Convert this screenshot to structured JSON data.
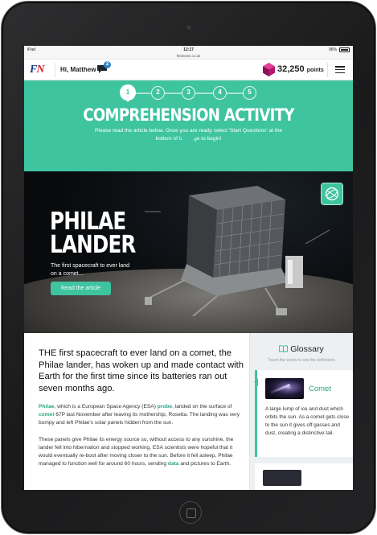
{
  "status_bar": {
    "device": "iPad",
    "time": "12:17",
    "url": "firstnews.co.uk",
    "battery": "96%"
  },
  "header": {
    "logo_first": "F",
    "logo_second": "N",
    "greeting": "Hi, Matthew",
    "message_count": "2",
    "points_value": "32,250",
    "points_unit": "points"
  },
  "activity": {
    "steps": [
      "1",
      "2",
      "3",
      "4",
      "5"
    ],
    "current_step": 1,
    "title": "COMPREHENSION ACTIVITY",
    "description": "Please read the article below. Once you are ready select 'Start Questions' at the bottom of the page to begin!"
  },
  "hero": {
    "title_line1": "PHILAE",
    "title_line2": "LANDER",
    "subtitle": "The first spacecraft to ever land on a comet...",
    "button": "Read the article"
  },
  "article": {
    "lead": "THE first spacecraft to ever land on a comet, the Philae lander, has woken up and made contact with Earth for the first time since its batteries ran out seven months ago.",
    "p1": {
      "kw1": "Philae",
      "t1": ", which is a European Space Agency (ESA) ",
      "kw2": "probe",
      "t2": ", landed on the surface of ",
      "kw3": "comet",
      "t3": " 67P last November after leaving its mothership, Rosetta. The landing was very bumpy and left Philae's solar panels hidden from the sun."
    },
    "p2": {
      "t1": "These panels give Philae its energy source so, without access to any sunshine, the lander fell into hibernation and stopped working. ESA scientists were hopeful that it would eventually re-boot after moving closer to the sun. Before it fell asleep, Philae managed to function well for around 60 hours, sending ",
      "kw1": "data",
      "t2": " and pictures to Earth."
    }
  },
  "glossary": {
    "title": "Glossary",
    "hint": "Touch the words to see the definitions",
    "term": "Comet",
    "definition": "A large lump of ice and dust which orbits the sun. As a comet gets close to the sun it gives off gasses and dust, creating a distinctive tail."
  },
  "colors": {
    "accent": "#3fc4a0",
    "accent_text": "#2aa387",
    "logo_blue": "#1b3d8f",
    "logo_red": "#d6202b",
    "badge_blue": "#2f87c9",
    "gem_magenta": "#b2166e"
  },
  "icons": {
    "message": "speech-bubble-icon",
    "points": "gem-icon",
    "menu": "hamburger-menu-icon",
    "globe": "globe-icon",
    "glossary": "book-icon"
  }
}
